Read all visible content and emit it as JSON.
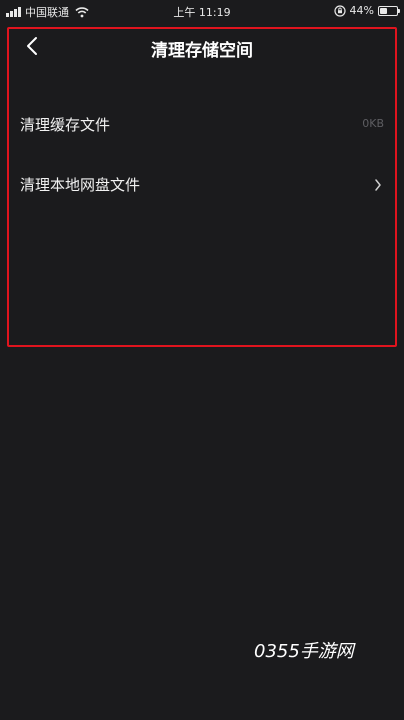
{
  "status_bar": {
    "carrier": "中国联通",
    "time": "上午 11:19",
    "battery": "44%",
    "battery_level": 0.44
  },
  "nav": {
    "title": "清理存储空间",
    "back_icon": "chevron-left-icon"
  },
  "items": [
    {
      "label": "清理缓存文件",
      "value": "0KB"
    },
    {
      "label": "清理本地网盘文件",
      "icon": "chevron-right-icon"
    }
  ],
  "watermark": "0355手游网",
  "colors": {
    "background": "#1b1b1d",
    "highlight_border": "#e0141e",
    "secondary_text": "#5e5e62"
  }
}
